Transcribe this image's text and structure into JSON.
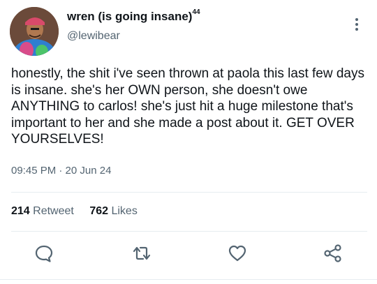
{
  "user": {
    "display_name": "wren (is going insane)",
    "display_name_suffix": "44",
    "handle": "@lewibear",
    "avatar": "profile-photo"
  },
  "tweet": {
    "text": "honestly, the shit i've seen thrown at paola this last few days is insane. she's her OWN person, she doesn't owe ANYTHING to carlos! she's just hit a huge milestone that's important to her and she made a post about it. GET OVER YOURSELVES!",
    "timestamp": "09:45 PM · 20 Jun 24"
  },
  "stats": {
    "retweets_count": "214",
    "retweets_label": "Retweet",
    "likes_count": "762",
    "likes_label": "Likes"
  },
  "actions": {
    "reply_icon": "reply-icon",
    "retweet_icon": "retweet-icon",
    "like_icon": "heart-icon",
    "share_icon": "share-icon"
  },
  "colors": {
    "text": "#0f1419",
    "secondary": "#536471",
    "divider": "#e6ecf0"
  }
}
